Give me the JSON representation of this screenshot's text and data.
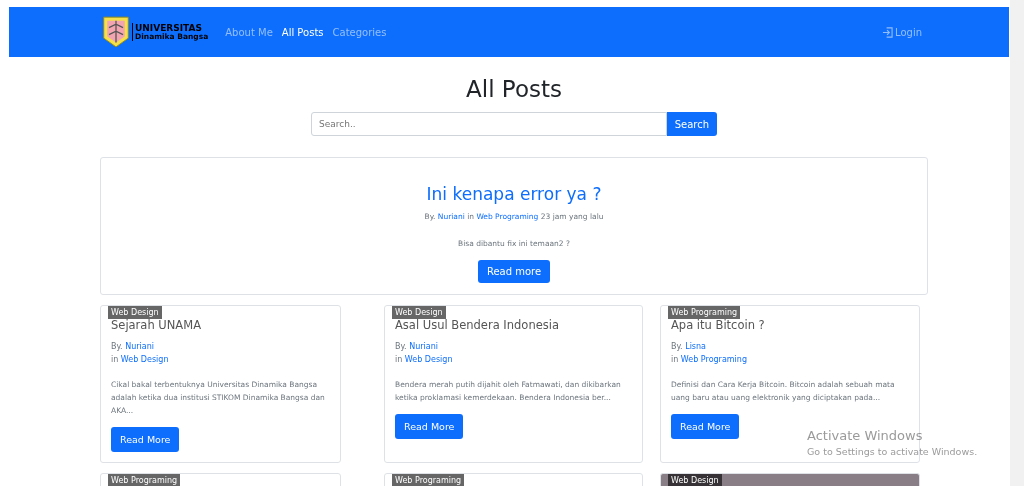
{
  "navbar": {
    "brand": {
      "line1": "UNIVERSITAS",
      "line2": "Dinamika Bangsa"
    },
    "links": [
      {
        "label": "About Me",
        "selected": false
      },
      {
        "label": "All Posts",
        "selected": true
      },
      {
        "label": "Categories",
        "selected": false
      }
    ],
    "login": "Login"
  },
  "heading": "All Posts",
  "search": {
    "placeholder": "Search..",
    "button": "Search"
  },
  "featured": {
    "title": "Ini kenapa error ya ?",
    "by": "By.",
    "author": "Nuriani",
    "in": "in",
    "category": "Web Programing",
    "time": "23 jam yang lalu",
    "excerpt": "Bisa dibantu fix ini temaan2 ?",
    "button": "Read more"
  },
  "posts": [
    {
      "kind": "text",
      "badge": "Web Design",
      "title": "Sejarah UNAMA",
      "by": "By.",
      "author": "Nuriani",
      "in": "in",
      "category": "Web Design",
      "excerpt": "Cikal bakal terbentuknya Universitas Dinamika Bangsa adalah ketika dua institusi STIKOM Dinamika Bangsa dan AKA...",
      "button": "Read More"
    },
    {
      "kind": "text",
      "badge": "Web Design",
      "title": "Asal Usul Bendera Indonesia",
      "by": "By.",
      "author": "Nuriani",
      "in": "in",
      "category": "Web Design",
      "excerpt": "Bendera merah putih dijahit oleh Fatmawati, dan dikibarkan ketika proklamasi kemerdekaan. Bendera Indonesia ber...",
      "button": "Read More"
    },
    {
      "kind": "text",
      "badge": "Web Programing",
      "title": "Apa itu Bitcoin ?",
      "by": "By.",
      "author": "Lisna",
      "in": "in",
      "category": "Web Programing",
      "excerpt": "Definisi dan Cara Kerja Bitcoin. Bitcoin adalah sebuah mata uang baru atau uang elektronik yang diciptakan pada...",
      "button": "Read More"
    },
    {
      "kind": "text",
      "badge": "Web Programing"
    },
    {
      "kind": "text",
      "badge": "Web Programing"
    },
    {
      "kind": "photo",
      "badge": "Web Design"
    }
  ],
  "os_notice": {
    "title": "Activate Windows",
    "subtitle": "Go to Settings to activate Windows."
  }
}
